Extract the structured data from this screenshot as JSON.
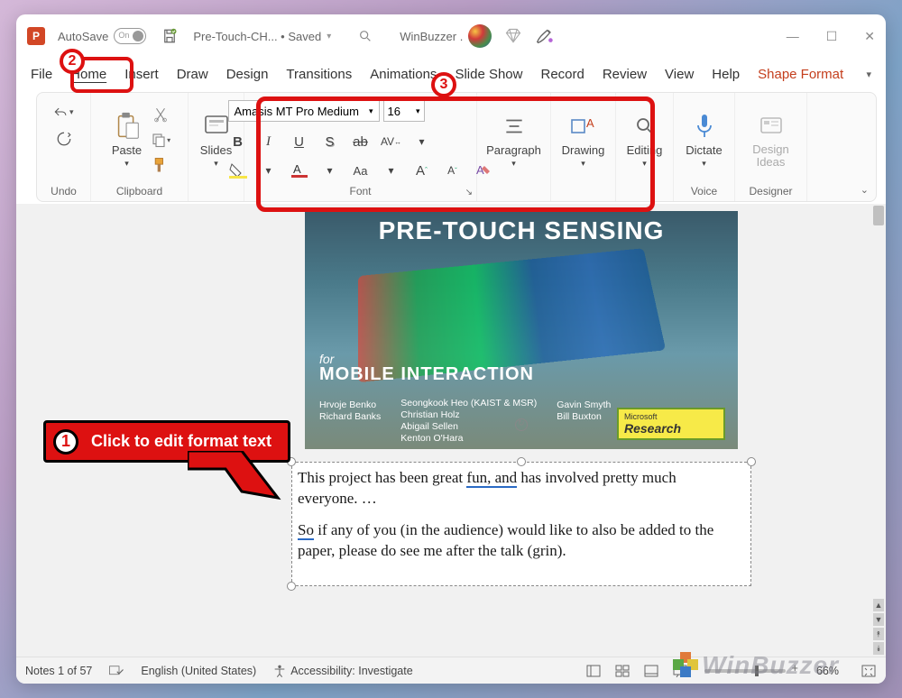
{
  "app": {
    "icon_letter": "P"
  },
  "titlebar": {
    "autosave_label": "AutoSave",
    "autosave_toggle_text": "On",
    "doc_title": "Pre-Touch-CH... • Saved",
    "user_name": "WinBuzzer ."
  },
  "tabs": {
    "file": "File",
    "home": "Home",
    "insert": "Insert",
    "draw": "Draw",
    "design": "Design",
    "transitions": "Transitions",
    "animations": "Animations",
    "slideshow": "Slide Show",
    "record": "Record",
    "review": "Review",
    "view": "View",
    "help": "Help",
    "shape_format": "Shape Format"
  },
  "ribbon": {
    "undo_label": "Undo",
    "clipboard_label": "Clipboard",
    "paste_label": "Paste",
    "slides_label": "Slides",
    "font_label": "Font",
    "font_name": "Amasis MT Pro Medium",
    "font_size": "16",
    "paragraph_label": "Paragraph",
    "drawing_label": "Drawing",
    "editing_label": "Editing",
    "dictate_label": "Dictate",
    "voice_label": "Voice",
    "design_ideas_label": "Design Ideas",
    "designer_label": "Designer"
  },
  "slide_image": {
    "title1": "PRE-TOUCH SENSING",
    "for_text": "for",
    "title2": "MOBILE INTERACTION",
    "badge_top": "Microsoft",
    "badge_bottom": "Research",
    "authors_col2": [
      "Seongkook Heo (KAIST & MSR)",
      "Christian Holz",
      "Abigail Sellen",
      "Kenton O'Hara"
    ],
    "authors_col1": [
      "",
      "",
      "Hrvoje Benko",
      "Richard Banks"
    ],
    "authors_col3": [
      "",
      "",
      "Gavin Smyth",
      "Bill Buxton"
    ]
  },
  "textbox": {
    "p1_a": "This project has been great ",
    "p1_err": "fun, and",
    "p1_b": " has involved pretty much everyone. …",
    "p2_err": "So",
    "p2_rest": " if any of you (in the audience) would like to also be added to the paper, please do see me after the talk (grin)."
  },
  "callouts": {
    "c1_num": "1",
    "c1_text": "Click to edit format text",
    "c2_num": "2",
    "c3_num": "3"
  },
  "statusbar": {
    "notes_count": "Notes 1 of 57",
    "language": "English (United States)",
    "accessibility": "Accessibility: Investigate",
    "zoom": "66%"
  },
  "watermark": "WinBuzzer"
}
